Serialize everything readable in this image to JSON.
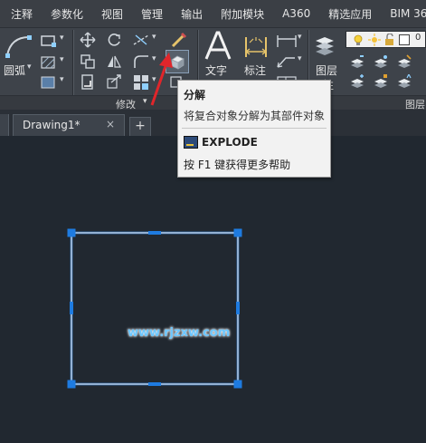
{
  "menu": {
    "items": [
      "注释",
      "参数化",
      "视图",
      "管理",
      "输出",
      "附加模块",
      "A360",
      "精选应用",
      "BIM 36"
    ]
  },
  "ribbon": {
    "draw_arc_label": "圆弧",
    "modify_panel_label": "修改",
    "modify_panel_arrow": "▾",
    "text_label": "文字",
    "dimension_label": "标注",
    "layers_label": "图层",
    "layers_label_cut": "性",
    "layers_panel_label": "图层"
  },
  "tooltip": {
    "title": "分解",
    "description": "将复合对象分解为其部件对象",
    "command": "EXPLODE",
    "help": "按 F1 键获得更多帮助"
  },
  "tabs": {
    "drawing_tab": "Drawing1*",
    "close_glyph": "×",
    "new_tab_glyph": "+"
  },
  "canvas": {
    "watermark": "www.rjzxw.com"
  },
  "colors": {
    "accent": "#e0262b",
    "grip": "#1e7be0",
    "selection_line": "#cfe3ff",
    "watermark": "#6cc7ff"
  }
}
